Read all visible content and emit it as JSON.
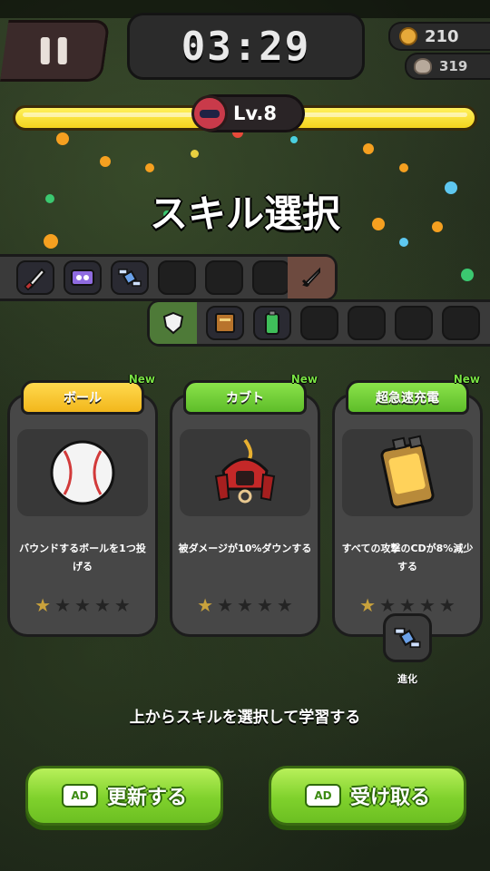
{
  "hud": {
    "timer": "03:29",
    "coins": "210",
    "kills": "319",
    "level": "Lv.8"
  },
  "title": "スキル選択",
  "weapon_slots": [
    "knife-icon",
    "tape-icon",
    "drone-icon",
    "empty",
    "empty",
    "empty"
  ],
  "weapon_tab_icon": "sword-icon",
  "passive_tab_icon": "shield-icon",
  "passive_slots": [
    "book-icon",
    "battery-icon",
    "empty",
    "empty",
    "empty",
    "empty"
  ],
  "cards": [
    {
      "name": "ボール",
      "badge": "New",
      "description": "バウンドするボールを1つ投げる",
      "stars_filled": 1,
      "stars_total": 5,
      "icon": "baseball-icon",
      "tab_color": "#f2b71c"
    },
    {
      "name": "カブト",
      "badge": "New",
      "description": "被ダメージが10%ダウンする",
      "stars_filled": 1,
      "stars_total": 5,
      "icon": "samurai-helmet-icon",
      "tab_color": "#5ebd2a"
    },
    {
      "name": "超急速充電",
      "badge": "New",
      "description": "すべての攻撃のCDが8%減少する",
      "stars_filled": 1,
      "stars_total": 5,
      "icon": "battery-icon",
      "tab_color": "#5ebd2a"
    }
  ],
  "evolve": {
    "label": "進化",
    "icon": "drone-icon"
  },
  "instruction": "上からスキルを選択して学習する",
  "buttons": {
    "refresh": "更新する",
    "receive": "受け取る",
    "ad_label": "AD"
  },
  "colors": {
    "accent_green": "#7fd12c",
    "accent_yellow": "#f4d31e",
    "card_bg": "#474747"
  }
}
